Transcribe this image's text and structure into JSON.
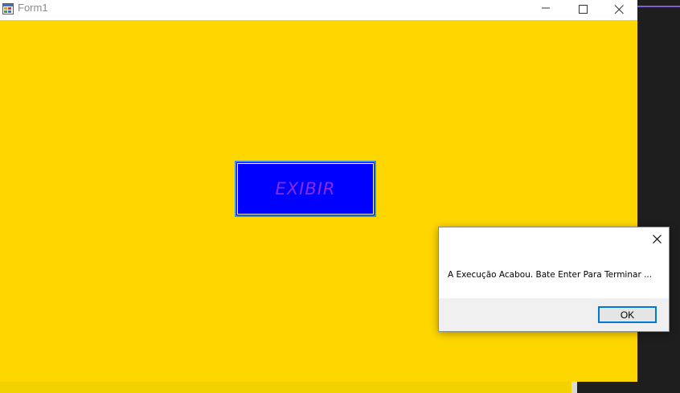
{
  "window": {
    "title": "Form1",
    "background_color": "#ffd700"
  },
  "main": {
    "exibir_label": "EXIBIR",
    "exibir_bg_color": "#0000ff",
    "exibir_text_color": "#8a2be2"
  },
  "dialog": {
    "message": "A Execução Acabou. Bate Enter Para Terminar ...",
    "ok_label": "OK"
  },
  "icons": {
    "app": "form-app-icon",
    "minimize": "minimize-icon",
    "maximize": "maximize-icon",
    "close": "close-icon",
    "dialog_close": "close-icon"
  }
}
